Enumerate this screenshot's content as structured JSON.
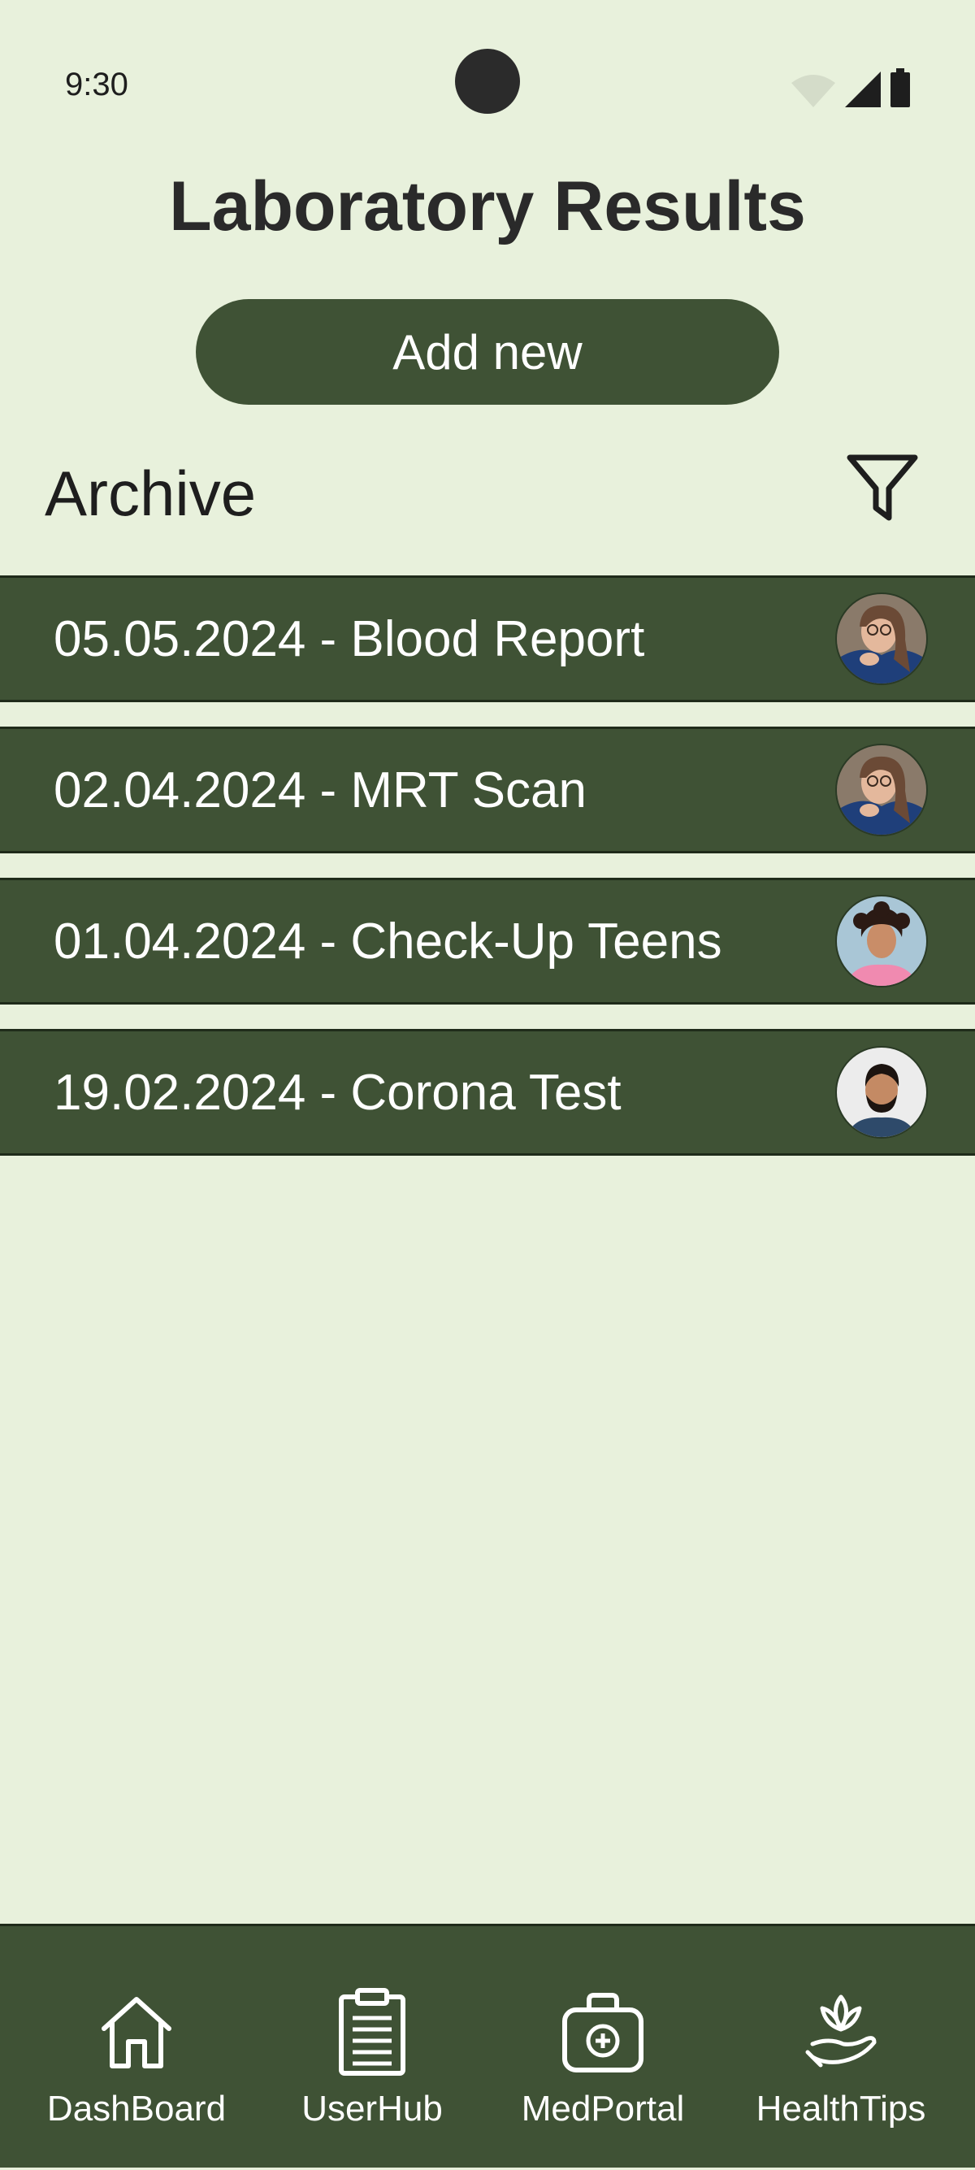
{
  "status_bar": {
    "time": "9:30"
  },
  "header": {
    "title": "Laboratory Results"
  },
  "actions": {
    "add_new_label": "Add new"
  },
  "archive": {
    "title": "Archive",
    "filter_icon": "filter-icon",
    "items": [
      {
        "label": "05.05.2024 - Blood Report",
        "avatar": "woman-glasses-avatar"
      },
      {
        "label": "02.04.2024 - MRT Scan",
        "avatar": "woman-glasses-avatar"
      },
      {
        "label": "01.04.2024 - Check-Up Teens",
        "avatar": "girl-curly-hair-avatar"
      },
      {
        "label": "19.02.2024 - Corona Test",
        "avatar": "man-beard-avatar"
      }
    ]
  },
  "bottom_nav": {
    "items": [
      {
        "label": "DashBoard",
        "icon": "home-icon"
      },
      {
        "label": "UserHub",
        "icon": "clipboard-icon"
      },
      {
        "label": "MedPortal",
        "icon": "medical-kit-icon"
      },
      {
        "label": "HealthTips",
        "icon": "lotus-hand-icon"
      }
    ]
  },
  "colors": {
    "background": "#e8f1dc",
    "accent": "#3f5235",
    "text_dark": "#1e1e1e",
    "text_light": "#ffffff"
  }
}
